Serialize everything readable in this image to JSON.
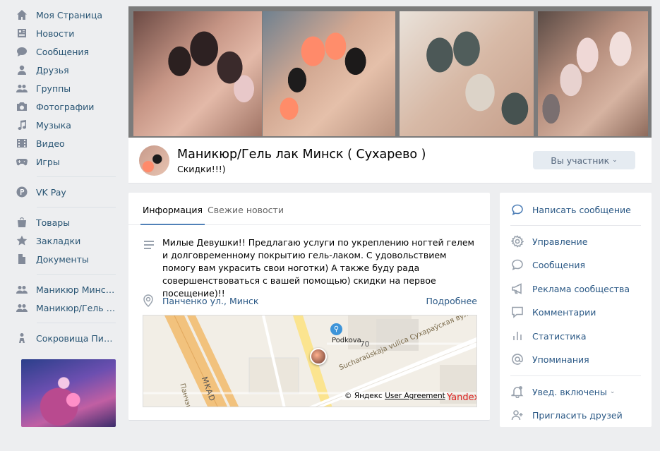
{
  "nav": {
    "items": [
      {
        "label": "Моя Страница",
        "icon": "home-icon"
      },
      {
        "label": "Новости",
        "icon": "news-icon"
      },
      {
        "label": "Сообщения",
        "icon": "messages-icon"
      },
      {
        "label": "Друзья",
        "icon": "friends-icon"
      },
      {
        "label": "Группы",
        "icon": "groups-icon"
      },
      {
        "label": "Фотографии",
        "icon": "camera-icon"
      },
      {
        "label": "Музыка",
        "icon": "music-icon"
      },
      {
        "label": "Видео",
        "icon": "video-icon"
      },
      {
        "label": "Игры",
        "icon": "games-icon"
      },
      {
        "label": "VK Pay",
        "icon": "vkpay-icon"
      },
      {
        "label": "Товары",
        "icon": "bag-icon"
      },
      {
        "label": "Закладки",
        "icon": "star-icon"
      },
      {
        "label": "Документы",
        "icon": "document-icon"
      },
      {
        "label": "Маникюр Минск/С...",
        "icon": "group-icon"
      },
      {
        "label": "Маникюр/Гель лак...",
        "icon": "group-icon"
      },
      {
        "label": "Сокровища Пиратов",
        "icon": "game-app-icon"
      }
    ]
  },
  "group": {
    "title": "Маникюр/Гель лак Минск ( Сухарево )",
    "status": "Скидки!!!)",
    "member_button": "Вы участник"
  },
  "tabs": {
    "info": "Информация",
    "news": "Свежие новости"
  },
  "info": {
    "description": "Милые Девушки!! Предлагаю услуги по укреплению ногтей гелем и долговременному покрытию гель-лаком. С удовольствием помогу вам украсить свои ноготки) А также буду рада совершенствоваться с вашей помощью) скидки на первое посещение)!!",
    "address": "Панченко ул., Минск",
    "more": "Подробнее"
  },
  "map": {
    "place": "Podkova",
    "house_number": "70",
    "street_1": "Sucharaŭskaja vulica Сухараўская вул",
    "street_2": "Панчэнка",
    "ring_road": "MKAD",
    "copyright": "© Яндекс",
    "user_agreement": "User Agreement",
    "logo": "Yandex"
  },
  "actions": {
    "write_message": "Написать сообщение",
    "manage": "Управление",
    "messages": "Сообщения",
    "ads": "Реклама сообщества",
    "comments": "Комментарии",
    "stats": "Статистика",
    "mentions": "Упоминания",
    "notifications": "Увед. включены",
    "invite": "Пригласить друзей"
  },
  "colors": {
    "link": "#2a5885",
    "accent": "#5181b8",
    "background": "#edeef0"
  }
}
